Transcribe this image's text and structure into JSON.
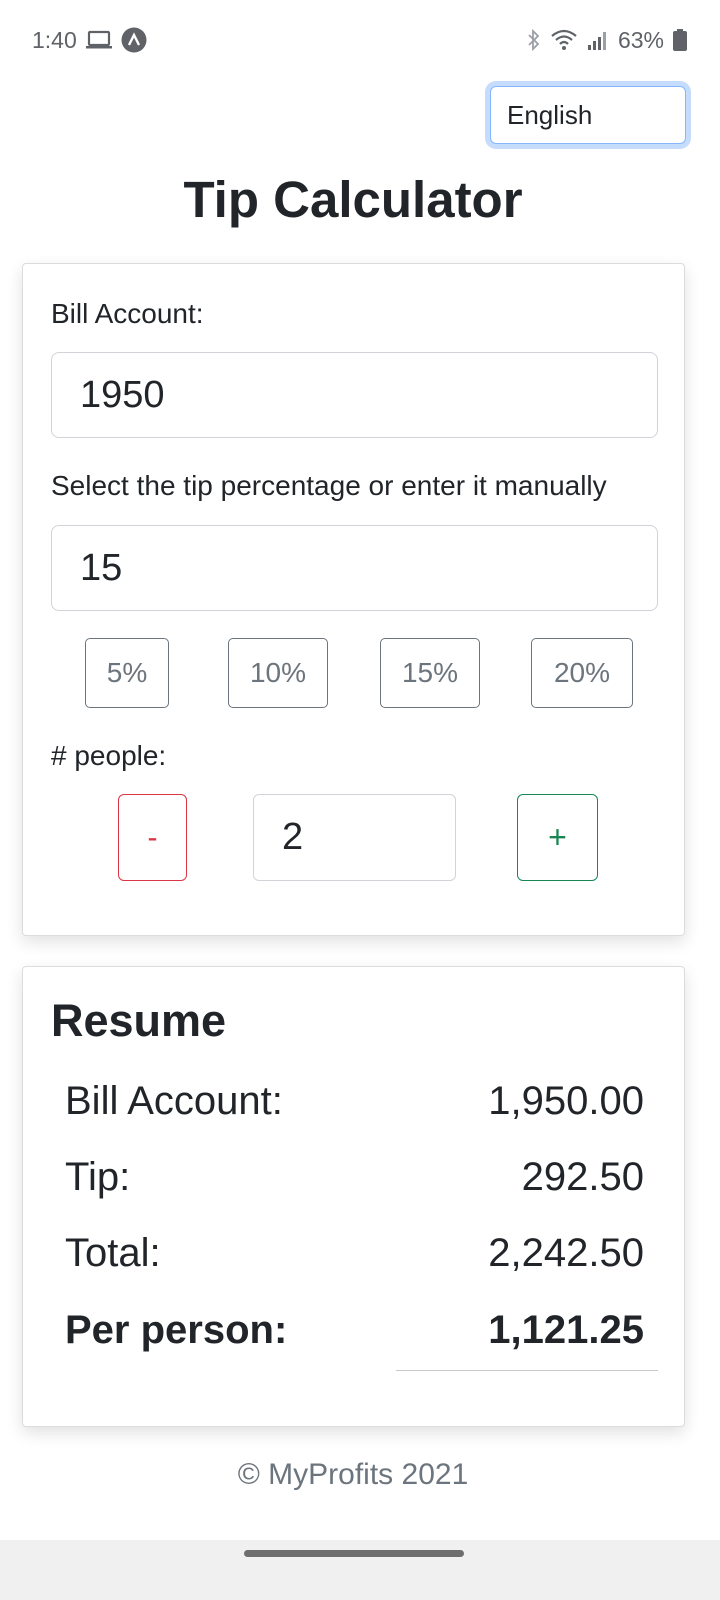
{
  "status_bar": {
    "time": "1:40",
    "battery": "63%",
    "icons": [
      "laptop-icon",
      "app-icon",
      "bluetooth-icon",
      "wifi-icon",
      "signal-icon",
      "battery-icon"
    ]
  },
  "language_select": {
    "value": "English"
  },
  "title": "Tip Calculator",
  "calculator": {
    "bill_label": "Bill Account:",
    "bill_value": "1950",
    "tip_label": "Select the tip percentage or enter it manually",
    "tip_value": "15",
    "tip_presets": [
      "5%",
      "10%",
      "15%",
      "20%"
    ],
    "people_label": "# people:",
    "minus_label": "-",
    "people_value": "2",
    "plus_label": "+"
  },
  "resume": {
    "heading": "Resume",
    "rows": [
      {
        "label": "Bill Account:",
        "value": "1,950.00"
      },
      {
        "label": "Tip:",
        "value": "292.50"
      },
      {
        "label": "Total:",
        "value": "2,242.50"
      },
      {
        "label": "Per person:",
        "value": "1,121.25"
      }
    ]
  },
  "footer": "© MyProfits 2021",
  "colors": {
    "danger": "#dc3545",
    "success": "#198754",
    "secondary": "#6c757d",
    "focus_ring": "#86b7fe"
  }
}
